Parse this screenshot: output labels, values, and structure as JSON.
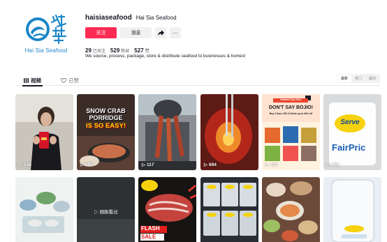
{
  "profile": {
    "brand_name": "Hai Sia Seafood",
    "username": "haisiaseafood",
    "nickname": "Hai Sia Seafood",
    "follow_label": "关注",
    "message_label": "消息",
    "share_icon": "share-icon",
    "more_label": "···",
    "following_count": "29",
    "following_label": "已关注",
    "followers_count": "529",
    "followers_label": "粉丝",
    "likes_count": "527",
    "likes_label": "赞",
    "bio": "We source, process, package, store & distribute seafood to businesses & homes!"
  },
  "tabs": {
    "videos_label": "视频",
    "liked_label": "已赞",
    "sort": [
      "最新",
      "热门",
      "最旧"
    ]
  },
  "videos": [
    {
      "views": "536"
    },
    {
      "views": "690",
      "caption_1": "SNOW CRAB",
      "caption_2": "PORRIDGE",
      "caption_3": "IS SO EASY!"
    },
    {
      "views": "117"
    },
    {
      "views": "694"
    },
    {
      "views": "132",
      "caption_1": "Hotdeal Sep 2024",
      "caption_2": "DON'T SAY BOJIO!",
      "caption_3": "Buy 3 Save 15% & Deals up to 40% off"
    },
    {
      "views": "701",
      "caption_1": "Serve",
      "caption_2": "FairPric"
    },
    {},
    {
      "overlay": "刚刚看过"
    },
    {
      "caption_1": "FLASH",
      "caption_2": "SALE"
    },
    {},
    {},
    {}
  ],
  "colors": {
    "brand_blue": "#1b86c8",
    "follow_red": "#fe2c55"
  }
}
